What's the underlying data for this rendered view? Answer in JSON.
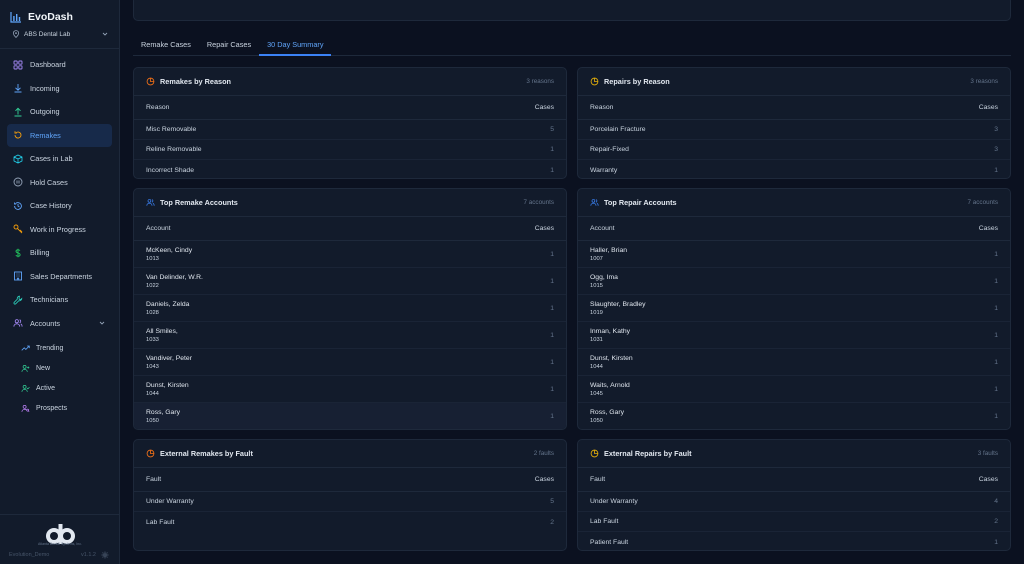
{
  "app": {
    "name": "EvoDash",
    "org": "ABS Dental Lab"
  },
  "nav": [
    {
      "label": "Dashboard",
      "icon": "grid-icon"
    },
    {
      "label": "Incoming",
      "icon": "download-icon"
    },
    {
      "label": "Outgoing",
      "icon": "upload-icon"
    },
    {
      "label": "Remakes",
      "icon": "rotate-icon"
    },
    {
      "label": "Cases in Lab",
      "icon": "box-icon"
    },
    {
      "label": "Hold Cases",
      "icon": "pause-circle-icon"
    },
    {
      "label": "Case History",
      "icon": "history-icon"
    },
    {
      "label": "Work in Progress",
      "icon": "key-icon"
    },
    {
      "label": "Billing",
      "icon": "dollar-icon"
    },
    {
      "label": "Sales Departments",
      "icon": "building-icon"
    },
    {
      "label": "Technicians",
      "icon": "wrench-icon"
    },
    {
      "label": "Accounts",
      "icon": "users-icon"
    }
  ],
  "subnav": [
    {
      "label": "Trending",
      "icon": "trending-icon"
    },
    {
      "label": "New",
      "icon": "user-plus-icon"
    },
    {
      "label": "Active",
      "icon": "user-check-icon"
    },
    {
      "label": "Prospects",
      "icon": "user-search-icon"
    }
  ],
  "footer": {
    "logo_text": "Atlanta Dental Systems, Inc.",
    "user": "Evolution_Demo",
    "version": "v1.1.2"
  },
  "tabs": [
    "Remake Cases",
    "Repair Cases",
    "30 Day Summary"
  ],
  "colors": {
    "accent": "#3b82f6",
    "remake_icon": "#f97316",
    "repair_icon": "#eab308",
    "account_icon": "#3b82f6"
  },
  "cards": {
    "remakes_by_reason": {
      "title": "Remakes by Reason",
      "count": "3 reasons",
      "col1": "Reason",
      "col2": "Cases",
      "rows": [
        {
          "label": "Misc Removable",
          "value": "5"
        },
        {
          "label": "Reline Removable",
          "value": "1"
        },
        {
          "label": "Incorrect Shade",
          "value": "1"
        }
      ]
    },
    "repairs_by_reason": {
      "title": "Repairs by Reason",
      "count": "3 reasons",
      "col1": "Reason",
      "col2": "Cases",
      "rows": [
        {
          "label": "Porcelain Fracture",
          "value": "3"
        },
        {
          "label": "Repair-Fixed",
          "value": "3"
        },
        {
          "label": "Warranty",
          "value": "1"
        }
      ]
    },
    "top_remake_accounts": {
      "title": "Top Remake Accounts",
      "count": "7 accounts",
      "col1": "Account",
      "col2": "Cases",
      "rows": [
        {
          "name": "McKeen, Cindy",
          "id": "1013",
          "value": "1"
        },
        {
          "name": "Van Delinder, W.R.",
          "id": "1022",
          "value": "1"
        },
        {
          "name": "Daniels, Zelda",
          "id": "1028",
          "value": "1"
        },
        {
          "name": "All Smiles,",
          "id": "1033",
          "value": "1"
        },
        {
          "name": "Vandiver, Peter",
          "id": "1043",
          "value": "1"
        },
        {
          "name": "Dunst, Kirsten",
          "id": "1044",
          "value": "1"
        },
        {
          "name": "Ross, Gary",
          "id": "1050",
          "value": "1"
        }
      ]
    },
    "top_repair_accounts": {
      "title": "Top Repair Accounts",
      "count": "7 accounts",
      "col1": "Account",
      "col2": "Cases",
      "rows": [
        {
          "name": "Haller, Brian",
          "id": "1007",
          "value": "1"
        },
        {
          "name": "Ogg, Ima",
          "id": "1015",
          "value": "1"
        },
        {
          "name": "Slaughter, Bradley",
          "id": "1019",
          "value": "1"
        },
        {
          "name": "Inman, Kathy",
          "id": "1031",
          "value": "1"
        },
        {
          "name": "Dunst, Kirsten",
          "id": "1044",
          "value": "1"
        },
        {
          "name": "Waits, Arnold",
          "id": "1045",
          "value": "1"
        },
        {
          "name": "Ross, Gary",
          "id": "1050",
          "value": "1"
        }
      ]
    },
    "external_remakes_by_fault": {
      "title": "External Remakes by Fault",
      "count": "2 faults",
      "col1": "Fault",
      "col2": "Cases",
      "rows": [
        {
          "label": "Under Warranty",
          "value": "5"
        },
        {
          "label": "Lab Fault",
          "value": "2"
        }
      ]
    },
    "external_repairs_by_fault": {
      "title": "External Repairs by Fault",
      "count": "3 faults",
      "col1": "Fault",
      "col2": "Cases",
      "rows": [
        {
          "label": "Under Warranty",
          "value": "4"
        },
        {
          "label": "Lab Fault",
          "value": "2"
        },
        {
          "label": "Patient Fault",
          "value": "1"
        }
      ]
    }
  }
}
